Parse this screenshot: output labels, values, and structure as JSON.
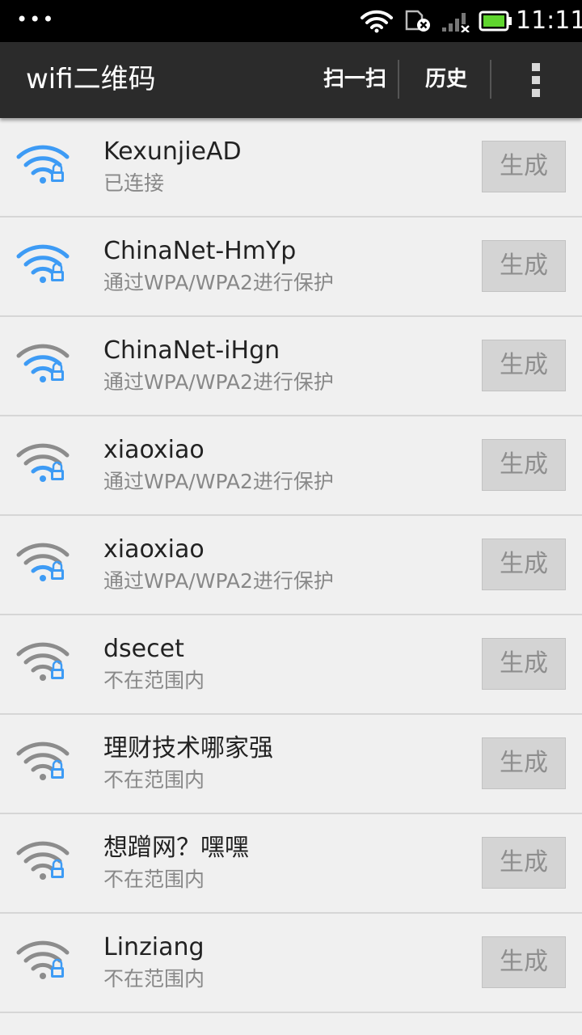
{
  "status_bar": {
    "time": "11:11",
    "icons": [
      "more-dots-icon",
      "wifi-icon",
      "sim-blocked-icon",
      "signal-icon",
      "battery-icon"
    ]
  },
  "action_bar": {
    "title": "wifi二维码",
    "scan_label": "扫一扫",
    "history_label": "历史"
  },
  "colors": {
    "strong_signal": "#3d9bf5",
    "weak_signal": "#8c8c8c",
    "action_bar_bg": "#2b2b2b",
    "list_bg": "#f0f0f0"
  },
  "networks": [
    {
      "ssid": "KexunjieAD",
      "status": "已连接",
      "signal_bars": 3,
      "button": "生成"
    },
    {
      "ssid": "ChinaNet-HmYp",
      "status": "通过WPA/WPA2进行保护",
      "signal_bars": 3,
      "button": "生成"
    },
    {
      "ssid": "ChinaNet-iHgn",
      "status": "通过WPA/WPA2进行保护",
      "signal_bars": 2,
      "button": "生成"
    },
    {
      "ssid": "xiaoxiao",
      "status": "通过WPA/WPA2进行保护",
      "signal_bars": 1,
      "button": "生成"
    },
    {
      "ssid": "xiaoxiao",
      "status": "通过WPA/WPA2进行保护",
      "signal_bars": 1,
      "button": "生成"
    },
    {
      "ssid": "dsecet",
      "status": "不在范围内",
      "signal_bars": 0,
      "button": "生成"
    },
    {
      "ssid": "理财技术哪家强",
      "status": "不在范围内",
      "signal_bars": 0,
      "button": "生成"
    },
    {
      "ssid": "想蹭网？嘿嘿",
      "status": "不在范围内",
      "signal_bars": 0,
      "button": "生成"
    },
    {
      "ssid": "Linziang",
      "status": "不在范围内",
      "signal_bars": 0,
      "button": "生成"
    }
  ]
}
